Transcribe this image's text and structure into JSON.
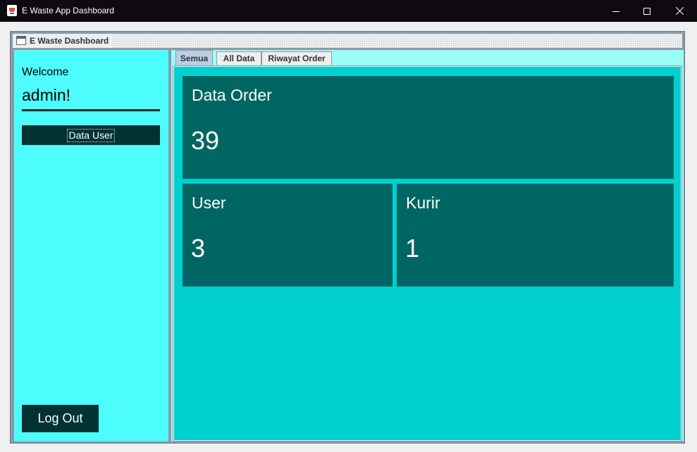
{
  "window": {
    "title": "E Waste App Dashboard"
  },
  "internal_frame": {
    "title": "E Waste Dashboard"
  },
  "sidebar": {
    "welcome": "Welcome",
    "username": "admin!",
    "data_user_label": "Data User",
    "logout_label": "Log Out"
  },
  "tabs": [
    {
      "label": "Semua",
      "active": true
    },
    {
      "label": "All Data",
      "active": false
    },
    {
      "label": "Riwayat Order",
      "active": false
    }
  ],
  "cards": {
    "order": {
      "label": "Data Order",
      "value": "39"
    },
    "user": {
      "label": "User",
      "value": "3"
    },
    "kurir": {
      "label": "Kurir",
      "value": "1"
    }
  },
  "colors": {
    "sidebar_bg": "#4dfcfc",
    "content_bg": "#00cfcf",
    "card_bg": "#006663",
    "button_bg": "#013334"
  }
}
